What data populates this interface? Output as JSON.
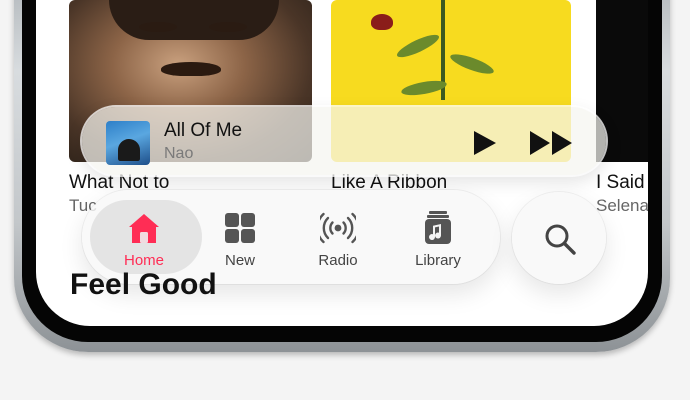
{
  "colors": {
    "accent": "#ff2d55",
    "tab_label": "#444444"
  },
  "albums": [
    {
      "title": "What Not to",
      "artist": "Tuc"
    },
    {
      "title": "Like A Ribbon",
      "artist": ""
    },
    {
      "title": "I Said",
      "artist": "Selena"
    }
  ],
  "now_playing": {
    "title": "All Of Me",
    "artist": "Nao",
    "icons": [
      "play-icon",
      "fast-forward-icon"
    ]
  },
  "tabs": [
    {
      "label": "Home",
      "icon": "house-icon",
      "selected": true
    },
    {
      "label": "New",
      "icon": "grid-icon",
      "selected": false
    },
    {
      "label": "Radio",
      "icon": "radio-waves-icon",
      "selected": false
    },
    {
      "label": "Library",
      "icon": "music-library-icon",
      "selected": false
    }
  ],
  "search": {
    "icon": "magnifier-icon"
  },
  "section": {
    "title": "Feel Good"
  }
}
